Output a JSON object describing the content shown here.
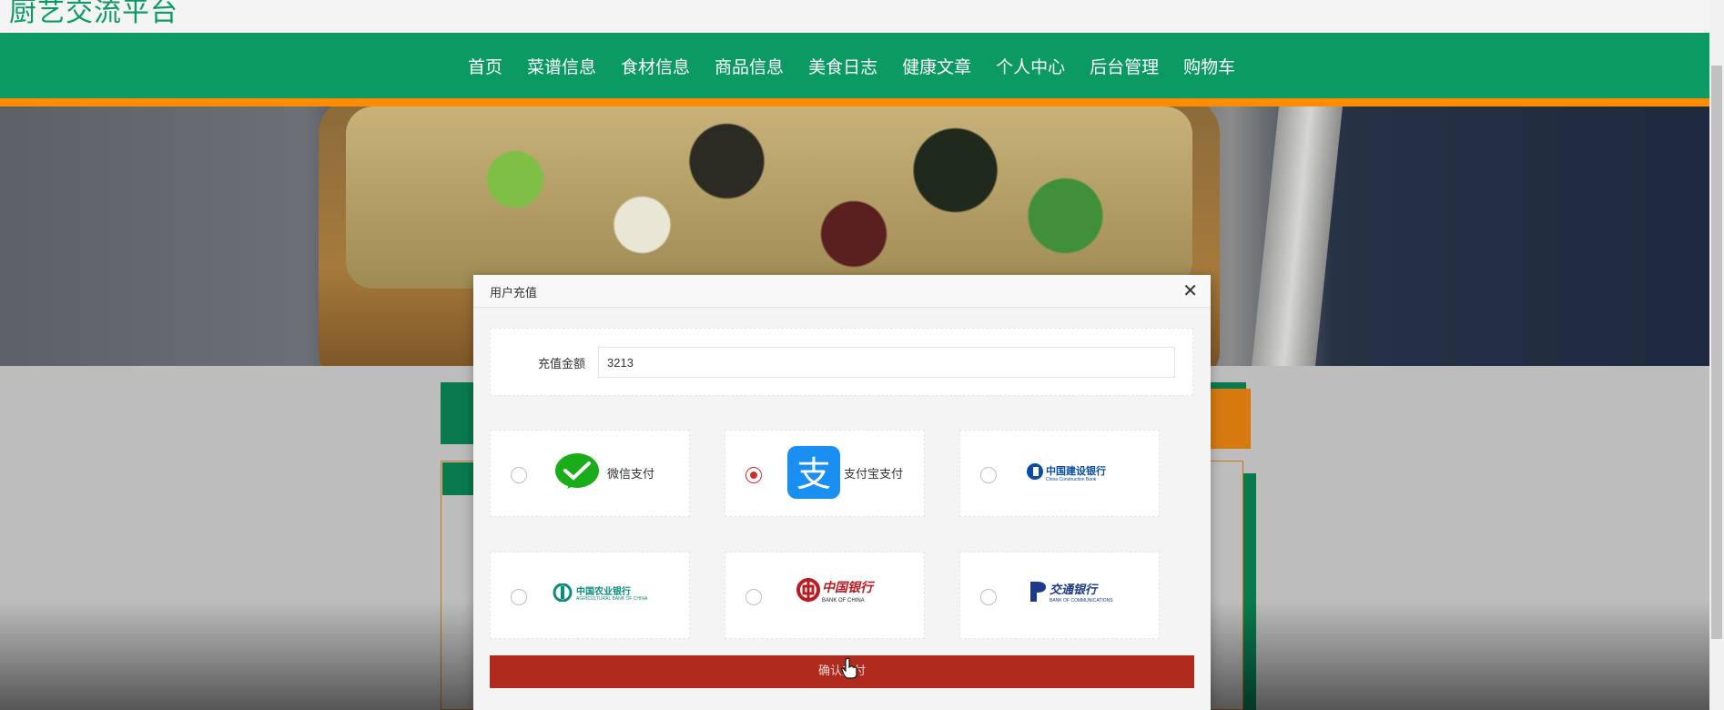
{
  "site": {
    "title": "厨艺交流平台"
  },
  "nav": {
    "items": [
      "首页",
      "菜谱信息",
      "食材信息",
      "商品信息",
      "美食日志",
      "健康文章",
      "个人中心",
      "后台管理",
      "购物车"
    ]
  },
  "dialog": {
    "title": "用户充值",
    "amount_label": "充值金额",
    "amount_value": "3213",
    "payment_options": [
      {
        "id": "wechat",
        "label": "微信支付",
        "selected": false,
        "icon": "wechat-pay-icon"
      },
      {
        "id": "alipay",
        "label": "支付宝支付",
        "selected": true,
        "icon": "alipay-icon"
      },
      {
        "id": "ccb",
        "label": "中国建设银行",
        "sub": "China Construction Bank",
        "selected": false,
        "icon": "ccb-logo"
      },
      {
        "id": "abc",
        "label": "中国农业银行",
        "sub": "AGRICULTURAL BANK OF CHINA",
        "selected": false,
        "icon": "abc-logo"
      },
      {
        "id": "boc",
        "label": "中国银行",
        "sub": "BANK OF CHINA",
        "selected": false,
        "icon": "boc-logo"
      },
      {
        "id": "bocom",
        "label": "交通银行",
        "sub": "BANK OF COMMUNICATIONS",
        "selected": false,
        "icon": "bocom-logo"
      }
    ],
    "confirm_label": "确认支付"
  },
  "colors": {
    "brand_green": "#0a9a62",
    "accent_orange": "#ff8c00",
    "confirm_red": "#b02a1e",
    "radio_selected": "#c9302c"
  }
}
